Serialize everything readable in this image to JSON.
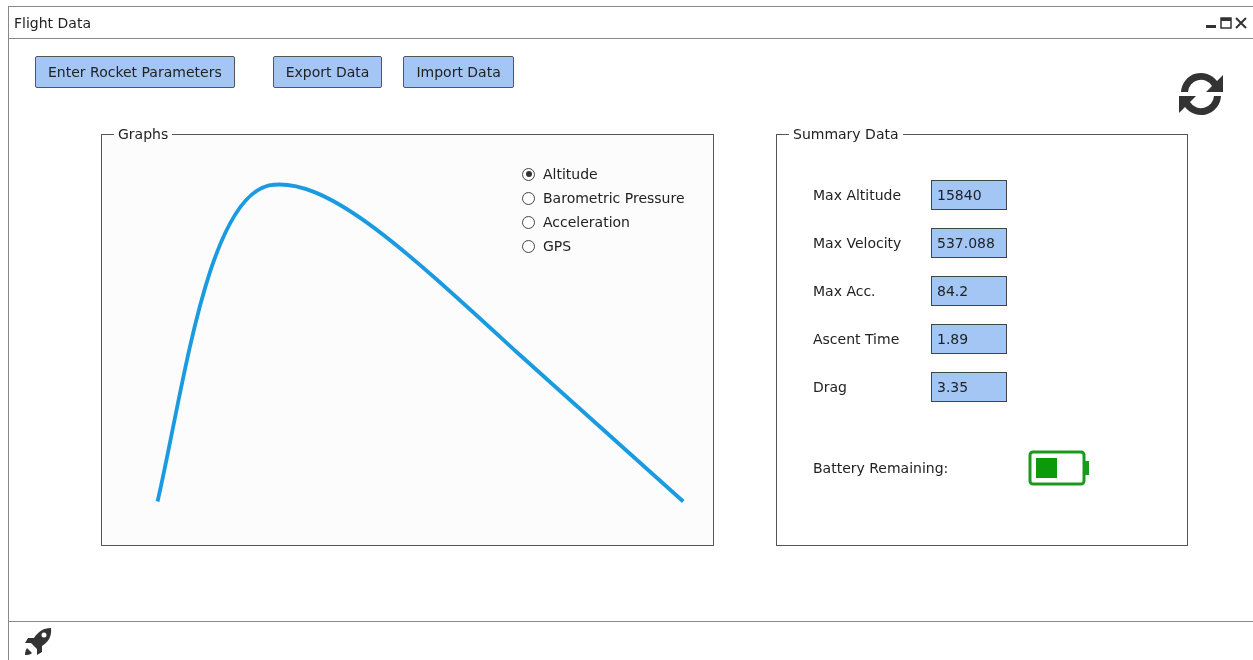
{
  "window": {
    "title": "Flight Data"
  },
  "buttons": [
    "Enter Rocket Parameters",
    "Export Data",
    "Import Data"
  ],
  "graphs": {
    "title": "Graphs",
    "options": [
      {
        "label": "Altitude",
        "selected": true
      },
      {
        "label": "Barometric Pressure",
        "selected": false
      },
      {
        "label": "Acceleration",
        "selected": false
      },
      {
        "label": "GPS",
        "selected": false
      }
    ]
  },
  "summary": {
    "title": "Summary Data",
    "fields": [
      {
        "label": "Max Altitude",
        "value": "15840"
      },
      {
        "label": "Max Velocity",
        "value": "537.088"
      },
      {
        "label": "Max Acc.",
        "value": "84.2"
      },
      {
        "label": "Ascent Time",
        "value": "1.89"
      },
      {
        "label": "Drag",
        "value": "3.35"
      }
    ],
    "battery": {
      "label": "Battery Remaining:"
    }
  }
}
